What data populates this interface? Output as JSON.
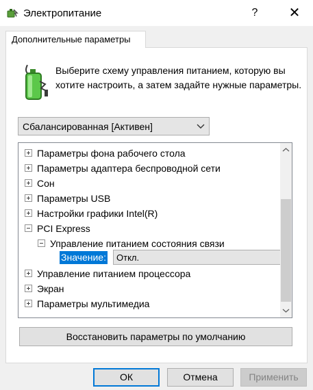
{
  "window": {
    "title": "Электропитание",
    "help_glyph": "?",
    "close_glyph": "✕",
    "icon": "power-options-icon"
  },
  "tab": {
    "label": "Дополнительные параметры"
  },
  "intro": {
    "text": "Выберите схему управления питанием, которую вы хотите настроить, а затем задайте нужные параметры.",
    "icon": "battery-icon"
  },
  "plan_select": {
    "value": "Сбалансированная [Активен]"
  },
  "tree": {
    "items": [
      {
        "label": "Параметры фона рабочего стола",
        "expander": "+"
      },
      {
        "label": "Параметры адаптера беспроводной сети",
        "expander": "+"
      },
      {
        "label": "Сон",
        "expander": "+"
      },
      {
        "label": "Параметры USB",
        "expander": "+"
      },
      {
        "label": "Настройки графики Intel(R)",
        "expander": "+"
      },
      {
        "label": "PCI Express",
        "expander": "-"
      },
      {
        "label": "Управление питанием состояния связи",
        "expander": "-"
      },
      {
        "label": "Управление питанием процессора",
        "expander": "+"
      },
      {
        "label": "Экран",
        "expander": "+"
      },
      {
        "label": "Параметры мультимедиа",
        "expander": "+"
      }
    ],
    "value_row": {
      "label": "Значение:",
      "value": "Откл."
    }
  },
  "buttons": {
    "restore": "Восстановить параметры по умолчанию",
    "ok": "ОК",
    "cancel": "Отмена",
    "apply": "Применить"
  },
  "colors": {
    "selection": "#0078d7",
    "accent_border": "#0078d7",
    "background": "#f0f0f0"
  }
}
